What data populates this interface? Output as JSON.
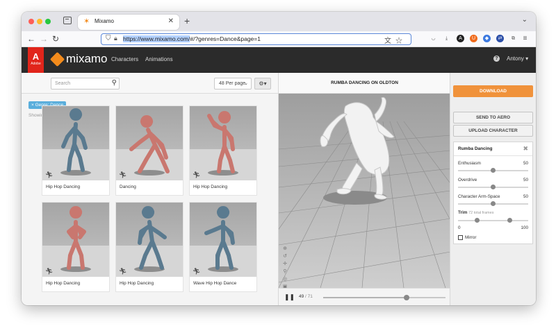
{
  "browser": {
    "tab_title": "Mixamo",
    "url_prefix": "https://www.mixamo.com/",
    "url_rest": "#/?genres=Dance&page=1"
  },
  "header": {
    "brand": "mixamo",
    "adobe_label": "Adobe",
    "nav": [
      "Characters",
      "Animations"
    ],
    "help_label": "?",
    "user": "Antony ▾"
  },
  "search": {
    "placeholder": "Search",
    "per_page": "48 Per page"
  },
  "filter_badge": "× Genre: Dance",
  "results_count": "Showing 1-48 of 147 results",
  "cards": [
    {
      "label": "Hip Hop Dancing",
      "color": "#5a7a8f"
    },
    {
      "label": "Dancing",
      "color": "#c9776f"
    },
    {
      "label": "Hip Hop Dancing",
      "color": "#c9776f"
    },
    {
      "label": "Hip Hop Dancing",
      "color": "#c9776f"
    },
    {
      "label": "Hip Hop Dancing",
      "color": "#5a7a8f"
    },
    {
      "label": "Wave Hip Hop Dance",
      "color": "#5a7a8f"
    }
  ],
  "viewer": {
    "title": "RUMBA DANCING ON OLDTON",
    "frame_current": "49",
    "frame_total": "/ 71",
    "progress": 0.68
  },
  "actions": {
    "download": "DOWNLOAD",
    "send": "SEND TO AERO",
    "upload": "UPLOAD CHARACTER"
  },
  "animation_panel": {
    "title": "Rumba Dancing",
    "params": [
      {
        "label": "Enthusiasm",
        "value": "50",
        "fraction": 0.5
      },
      {
        "label": "Overdrive",
        "value": "50",
        "fraction": 0.5
      },
      {
        "label": "Character Arm-Space",
        "value": "50",
        "fraction": 0.5
      }
    ],
    "trim_label": "Trim",
    "trim_note": "72 total frames",
    "trim_start_fraction": 0.27,
    "trim_end_fraction": 0.74,
    "trim_min": "0",
    "trim_max": "100",
    "mirror_label": "Mirror"
  },
  "colors": {
    "accent": "#f0923b",
    "badge": "#5aaedc",
    "adobe_red": "#e1251b"
  }
}
